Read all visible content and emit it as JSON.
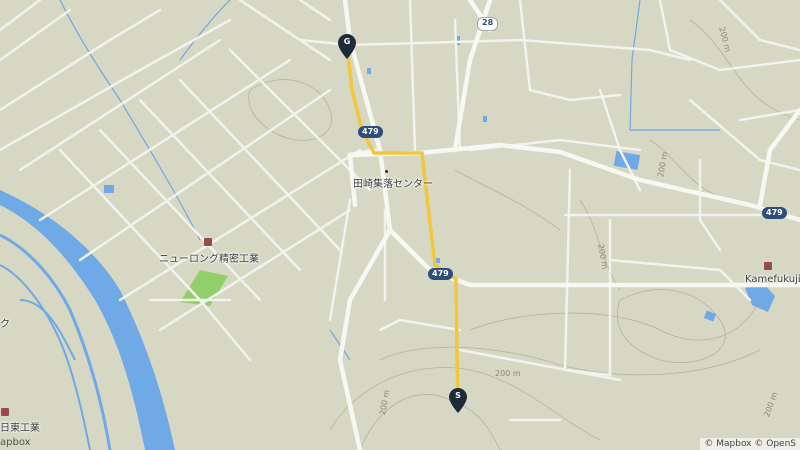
{
  "map": {
    "colors": {
      "land": "#d6d8c4",
      "road": "#f2f2ee",
      "water": "#6fa9e6",
      "park": "#92cf6a",
      "route": "#f3c73a",
      "pin": "#1f2a3a",
      "contour": "#a9ab95"
    },
    "places": {
      "community_center": "田崎集落センター",
      "factory_1": "ニューロング精密工業",
      "factory_2": "日東工業",
      "kamefukuji": "Kamefukuji Te",
      "left_edge": "ク"
    },
    "roads": {
      "r479_a": "479",
      "r479_b": "479",
      "r479_c": "479",
      "r28": "28"
    },
    "contours": [
      "200 m",
      "200 m",
      "200 m",
      "200 m",
      "200 m",
      "200 m"
    ],
    "markers": {
      "goal": "G",
      "start": "S"
    },
    "attribution": "© Mapbox © OpenS",
    "logo": "apbox"
  }
}
